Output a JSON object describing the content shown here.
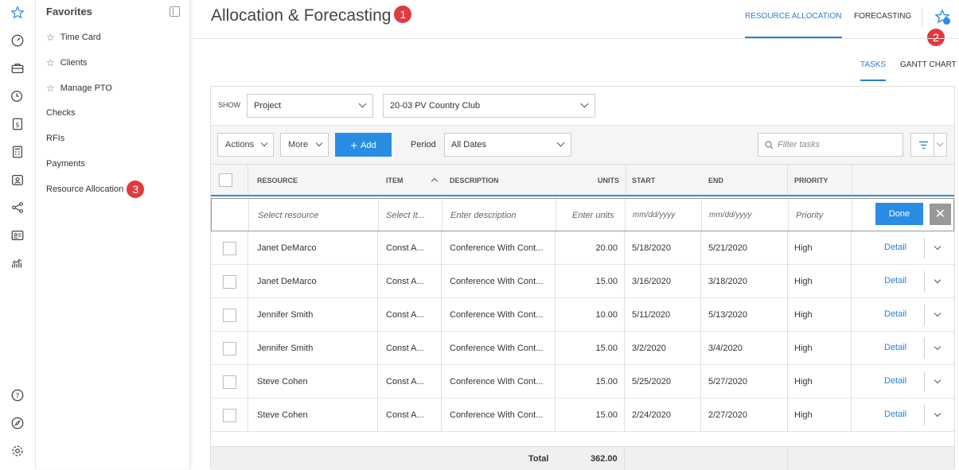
{
  "rail": {
    "icons": [
      "star-icon",
      "dashboard-icon",
      "briefcase-icon",
      "clock-dollar-icon",
      "invoice-icon",
      "calculator-icon",
      "id-badge-icon",
      "share-icon",
      "contact-card-icon",
      "chart-icon",
      "help-icon",
      "compass-icon",
      "settings-icon"
    ]
  },
  "favorites": {
    "title": "Favorites",
    "items": [
      {
        "label": "Time Card",
        "starred": true
      },
      {
        "label": "Clients",
        "starred": true
      },
      {
        "label": "Manage PTO",
        "starred": true
      },
      {
        "label": "Checks",
        "starred": false
      },
      {
        "label": "RFIs",
        "starred": false
      },
      {
        "label": "Payments",
        "starred": false
      },
      {
        "label": "Resource Allocation",
        "starred": false
      }
    ]
  },
  "badges": {
    "b1": "1",
    "b2": "2",
    "b3": "3"
  },
  "header": {
    "title": "Allocation & Forecasting",
    "tabs": [
      "RESOURCE ALLOCATION",
      "FORECASTING"
    ]
  },
  "subtabs": [
    "TASKS",
    "GANTT CHART"
  ],
  "filters": {
    "show_label": "SHOW",
    "show_value": "Project",
    "project_value": "20-03 PV Country Club"
  },
  "toolbar": {
    "actions": "Actions",
    "more": "More",
    "add": "Add",
    "period_label": "Period",
    "period_value": "All Dates",
    "filter_placeholder": "Filter tasks"
  },
  "columns": [
    "RESOURCE",
    "ITEM",
    "DESCRIPTION",
    "UNITS",
    "START",
    "END",
    "PRIORITY"
  ],
  "entry": {
    "resource": "Select resource",
    "item": "Select It...",
    "description": "Enter description",
    "units": "Enter units",
    "start": "mm/dd/yyyy",
    "end": "mm/dd/yyyy",
    "priority": "Priority",
    "done": "Done"
  },
  "rows": [
    {
      "resource": "Janet DeMarco",
      "item": "Const A...",
      "description": "Conference With Cont...",
      "units": "20.00",
      "start": "5/18/2020",
      "end": "5/21/2020",
      "priority": "High",
      "detail": "Detail"
    },
    {
      "resource": "Janet DeMarco",
      "item": "Const A...",
      "description": "Conference With Cont...",
      "units": "15.00",
      "start": "3/16/2020",
      "end": "3/18/2020",
      "priority": "High",
      "detail": "Detail"
    },
    {
      "resource": "Jennifer Smith",
      "item": "Const A...",
      "description": "Conference With Cont...",
      "units": "10.00",
      "start": "5/11/2020",
      "end": "5/13/2020",
      "priority": "High",
      "detail": "Detail"
    },
    {
      "resource": "Jennifer Smith",
      "item": "Const A...",
      "description": "Conference With Cont...",
      "units": "15.00",
      "start": "3/2/2020",
      "end": "3/4/2020",
      "priority": "High",
      "detail": "Detail"
    },
    {
      "resource": "Steve Cohen",
      "item": "Const A...",
      "description": "Conference With Cont...",
      "units": "15.00",
      "start": "5/25/2020",
      "end": "5/27/2020",
      "priority": "High",
      "detail": "Detail"
    },
    {
      "resource": "Steve Cohen",
      "item": "Const A...",
      "description": "Conference With Cont...",
      "units": "15.00",
      "start": "2/24/2020",
      "end": "2/27/2020",
      "priority": "High",
      "detail": "Detail"
    }
  ],
  "totals": {
    "label": "Total",
    "units": "362.00"
  },
  "colors": {
    "accent": "#2a8de4",
    "badge": "#e0393e"
  }
}
